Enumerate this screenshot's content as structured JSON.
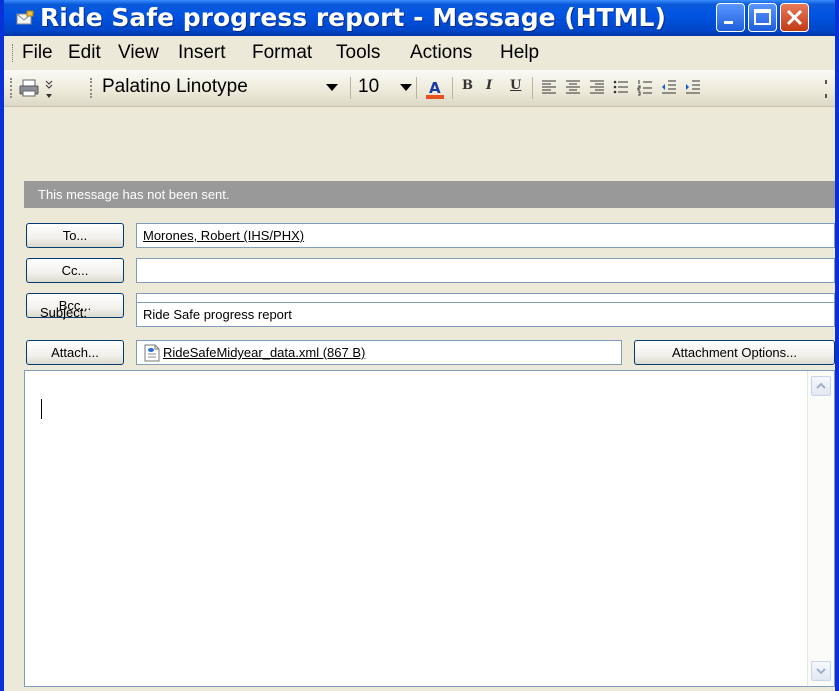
{
  "window": {
    "title": "Ride Safe progress report - Message (HTML)"
  },
  "menu": {
    "items": [
      "File",
      "Edit",
      "View",
      "Insert",
      "Format",
      "Tools",
      "Actions",
      "Help"
    ]
  },
  "toolbar": {
    "font_name": "Palatino Linotype",
    "font_size": "10",
    "bold": "B",
    "italic": "I",
    "underline": "U",
    "font_color": "#e8501e"
  },
  "info_bar": {
    "text": "This message has not been sent."
  },
  "header": {
    "to_button": "To...",
    "cc_button": "Cc...",
    "bcc_button": "Bcc...",
    "subject_label": "Subject:",
    "attach_button": "Attach...",
    "to_value": "Morones, Robert (IHS/PHX)",
    "cc_value": "",
    "bcc_value": "",
    "subject_value": "Ride Safe progress report",
    "attachment_file": "RideSafeMidyear_data.xml (867 B)",
    "attachment_options_button": "Attachment Options..."
  },
  "body": {
    "text": ""
  }
}
